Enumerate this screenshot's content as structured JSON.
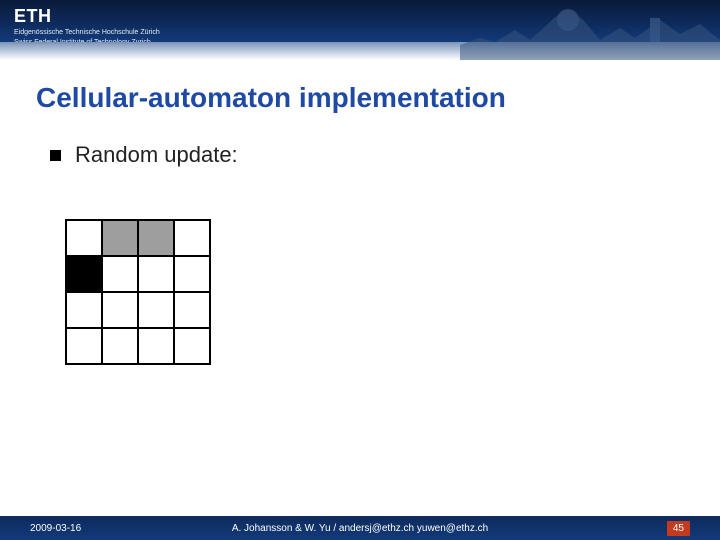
{
  "header": {
    "logo_text": "ETH",
    "logo_sub_line1": "Eidgenössische Technische Hochschule Zürich",
    "logo_sub_line2": "Swiss Federal Institute of Technology Zurich"
  },
  "title": "Cellular-automaton implementation",
  "bullet": "Random update:",
  "grid": {
    "cols": 4,
    "rows": 4,
    "cells": [
      [
        "w",
        "g",
        "g",
        "w"
      ],
      [
        "k",
        "w",
        "w",
        "w"
      ],
      [
        "w",
        "w",
        "w",
        "w"
      ],
      [
        "w",
        "w",
        "w",
        "w"
      ]
    ]
  },
  "footer": {
    "date": "2009-03-16",
    "authors": "A. Johansson & W. Yu / andersj@ethz.ch yuwen@ethz.ch",
    "page": "45"
  }
}
